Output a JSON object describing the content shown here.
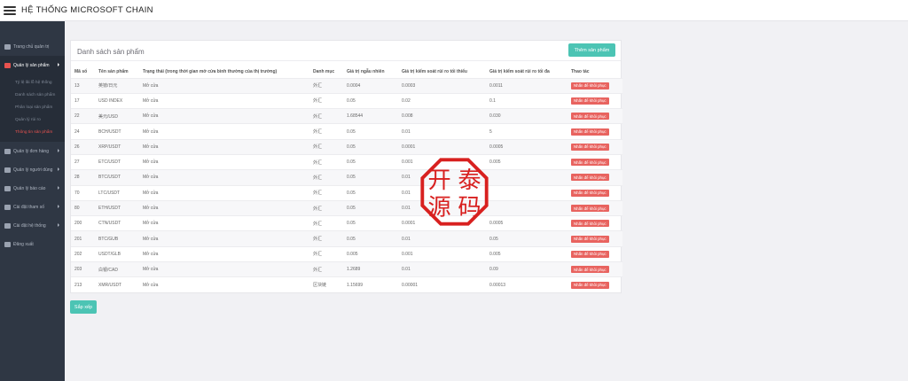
{
  "header": {
    "title": "HỆ THỐNG MICROSOFT CHAIN"
  },
  "sidebar": {
    "items": [
      {
        "label": "Trang chủ quản trị",
        "icon": "dashboard-icon"
      },
      {
        "label": "Quản lý sản phẩm",
        "icon": "product-icon",
        "open": true,
        "children": [
          {
            "label": "Tỷ lệ lãi lỗ hệ thống"
          },
          {
            "label": "Danh sách sản phẩm"
          },
          {
            "label": "Phân loại sản phẩm"
          },
          {
            "label": "Quản lý rủi ro"
          },
          {
            "label": "Thông tin sản phẩm",
            "active": true
          }
        ]
      },
      {
        "label": "Quản lý đơn hàng",
        "icon": "order-icon"
      },
      {
        "label": "Quản lý người dùng",
        "icon": "user-icon"
      },
      {
        "label": "Quản lý báo cáo",
        "icon": "report-icon"
      },
      {
        "label": "Cài đặt tham số",
        "icon": "params-icon"
      },
      {
        "label": "Cài đặt hệ thống",
        "icon": "settings-icon"
      },
      {
        "label": "Đăng xuất",
        "icon": "logout-icon"
      }
    ]
  },
  "main": {
    "title": "Danh sách sản phẩm",
    "add_button": "Thêm sản phẩm",
    "sort_button": "Sắp xếp",
    "columns": [
      "Mã số",
      "Tên sản phẩm",
      "Trạng thái (trong thời gian mở cửa bình thường của thị trường)",
      "Danh mục",
      "Giá trị ngẫu nhiên",
      "Giá trị kiểm soát rủi ro tối thiểu",
      "Giá trị kiểm soát rủi ro tối đa",
      "Thao tác"
    ],
    "rows": [
      [
        "13",
        "英镑/日元",
        "Mở cửa",
        "外汇",
        "0.0004",
        "0.0003",
        "0.0011",
        "Nhấn để khôi phục"
      ],
      [
        "17",
        "USD INDEX",
        "Mở cửa",
        "外汇",
        "0.05",
        "0.02",
        "0.1",
        "Nhấn để khôi phục"
      ],
      [
        "22",
        "美元/USD",
        "Mở cửa",
        "外汇",
        "1.68544",
        "0.008",
        "0.030",
        "Nhấn để khôi phục"
      ],
      [
        "24",
        "BCH/USDT",
        "Mở cửa",
        "外汇",
        "0.05",
        "0.01",
        "5",
        "Nhấn để khôi phục"
      ],
      [
        "26",
        "XRP/USDT",
        "Mở cửa",
        "外汇",
        "0.05",
        "0.0001",
        "0.0005",
        "Nhấn để khôi phục"
      ],
      [
        "27",
        "ETC/USDT",
        "Mở cửa",
        "外汇",
        "0.05",
        "0.001",
        "0.005",
        "Nhấn để khôi phục"
      ],
      [
        "28",
        "BTC/USDT",
        "Mở cửa",
        "外汇",
        "0.05",
        "0.01",
        "",
        "Nhấn để khôi phục"
      ],
      [
        "70",
        "LTC/USDT",
        "Mở cửa",
        "外汇",
        "0.05",
        "0.01",
        "",
        "Nhấn để khôi phục"
      ],
      [
        "80",
        "ETH/USDT",
        "Mở cửa",
        "外汇",
        "0.05",
        "0.01",
        "",
        "Nhấn để khôi phục"
      ],
      [
        "200",
        "CTN/USDT",
        "Mở cửa",
        "外汇",
        "0.05",
        "0.0001",
        "0.0005",
        "Nhấn để khôi phục"
      ],
      [
        "201",
        "BTC/GUB",
        "Mở cửa",
        "外汇",
        "0.05",
        "0.01",
        "0.05",
        "Nhấn để khôi phục"
      ],
      [
        "202",
        "USDT/GLB",
        "Mở cửa",
        "外汇",
        "0.005",
        "0.001",
        "0.005",
        "Nhấn để khôi phục"
      ],
      [
        "203",
        "白银/CAD",
        "Mở cửa",
        "外汇",
        "1.2689",
        "0.01",
        "0.09",
        "Nhấn để khôi phục"
      ],
      [
        "213",
        "XMR/USDT",
        "Mở cửa",
        "区块链",
        "1.15699",
        "0.00001",
        "0.00013",
        "Nhấn để khôi phục"
      ]
    ]
  },
  "watermark": {
    "chars": [
      "开",
      "泰",
      "源",
      "码"
    ],
    "color": "#d8201f"
  },
  "colors": {
    "accent": "#4cc4b4",
    "danger": "#e8635f",
    "sidebar": "#2f3744",
    "active": "#e8524f"
  }
}
